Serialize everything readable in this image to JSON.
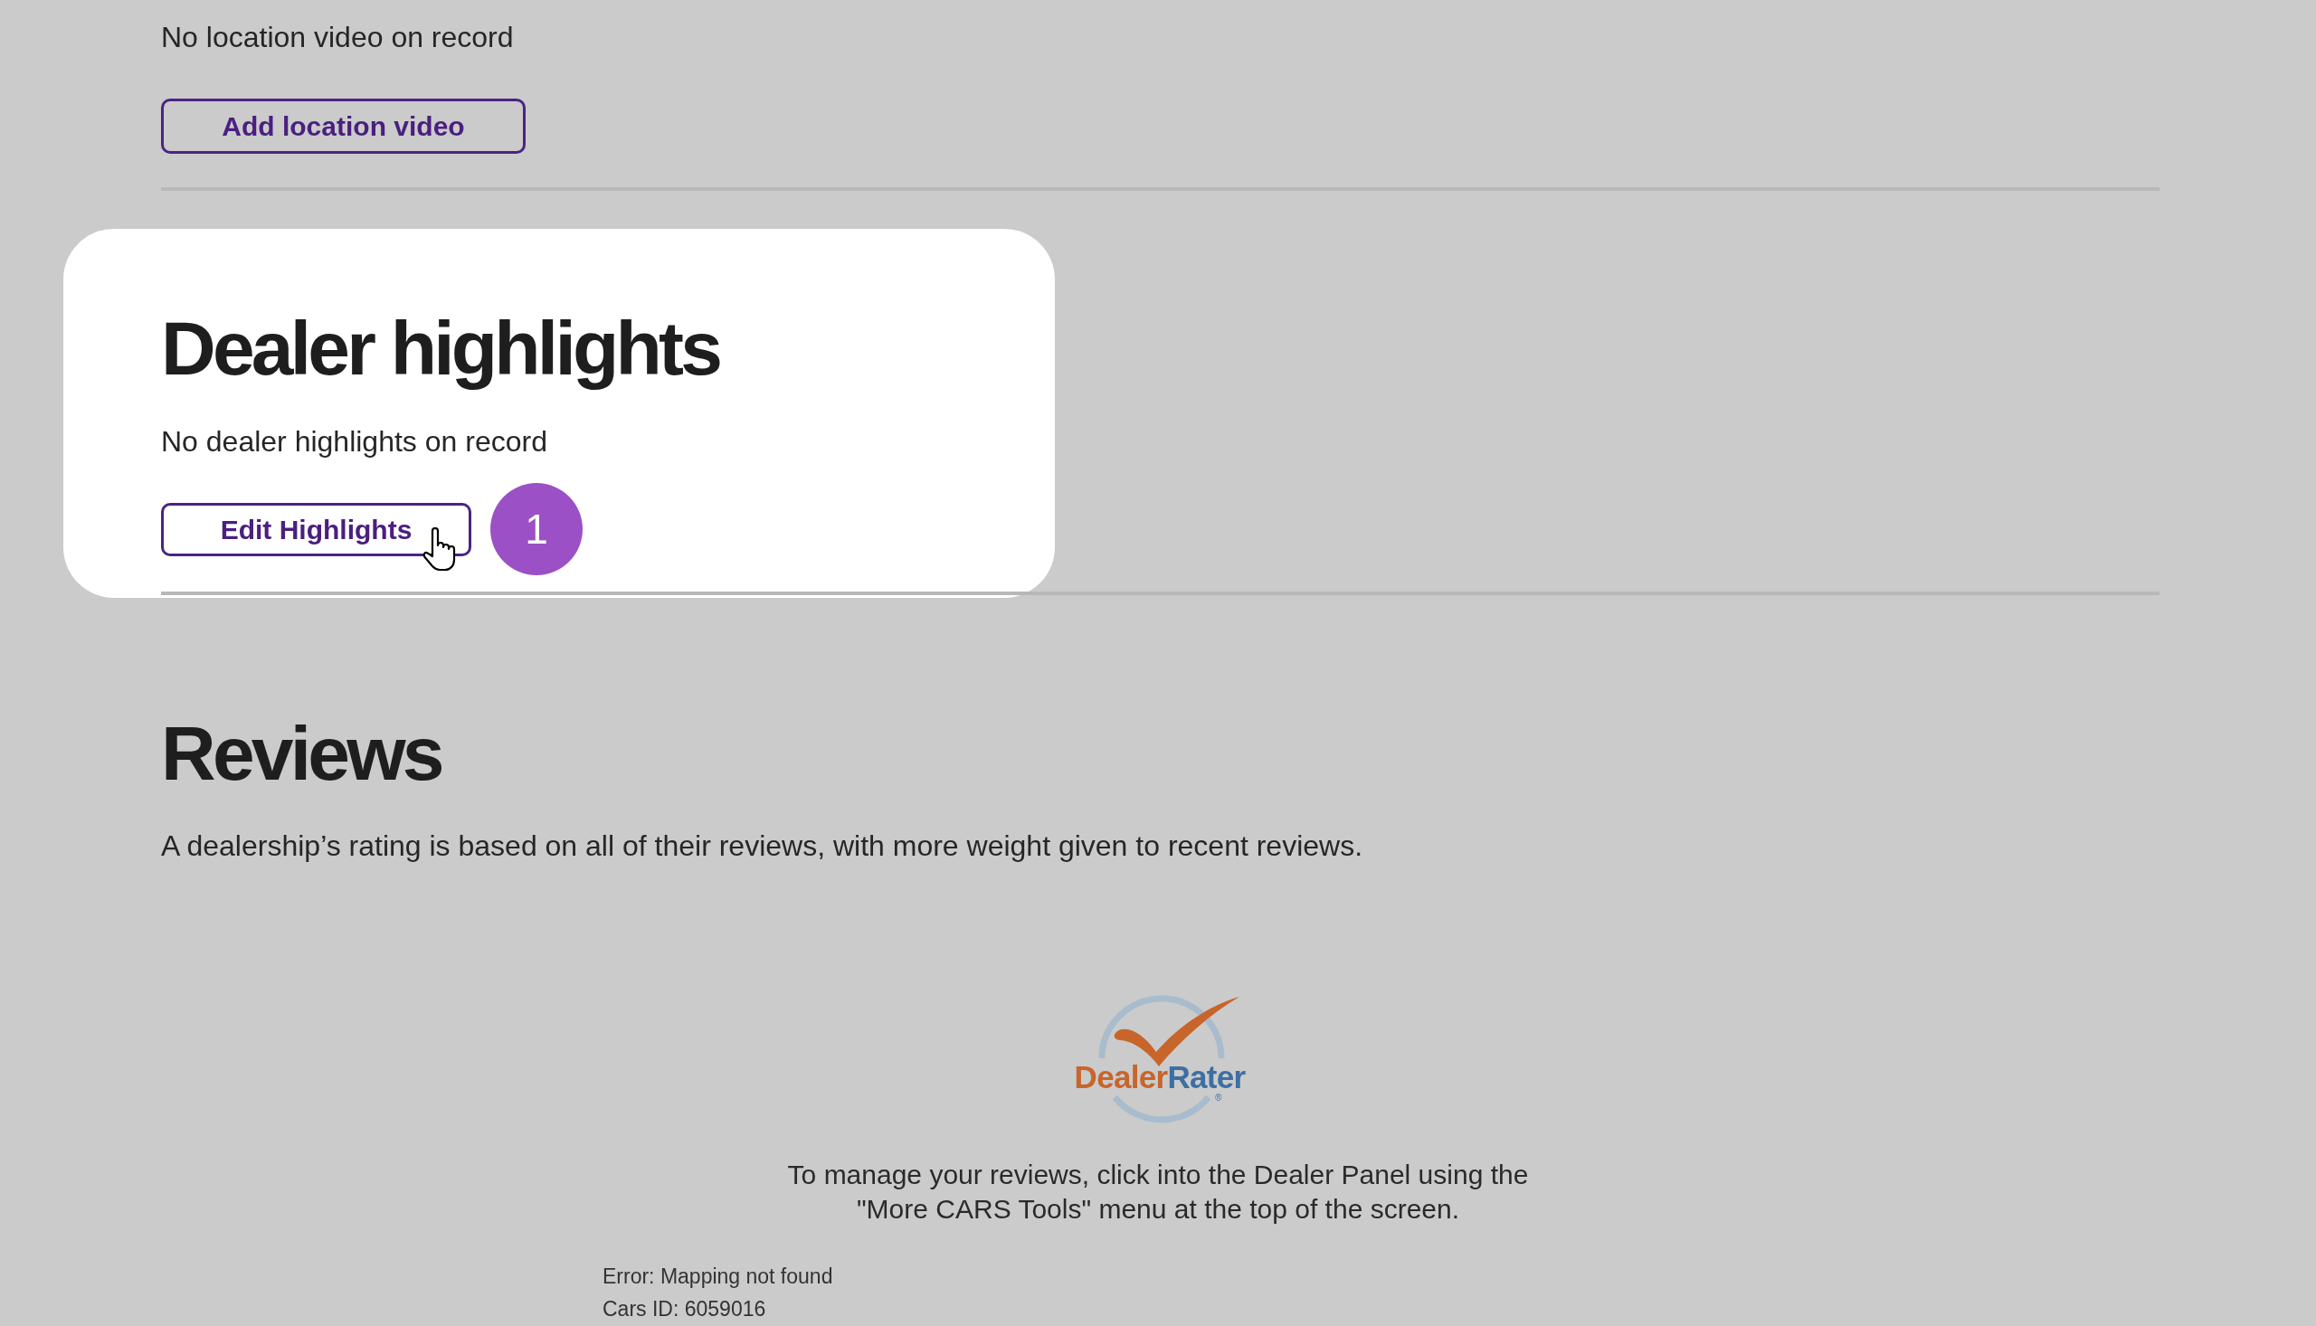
{
  "location_video": {
    "empty_message": "No location video on record",
    "add_button": "Add location video"
  },
  "dealer_highlights": {
    "title": "Dealer highlights",
    "empty_message": "No dealer highlights on record",
    "edit_button": "Edit Highlights",
    "step_badge": "1"
  },
  "reviews": {
    "title": "Reviews",
    "description": "A dealership’s rating is based on all of their reviews, with more weight given to recent reviews.",
    "logo": {
      "wordmark": [
        {
          "text": "Dealer",
          "color": "#c8652b"
        },
        {
          "text": "Rater",
          "color": "#3d6fa3"
        }
      ],
      "registered_mark": "®"
    },
    "instructions": "To manage your reviews, click into the Dealer Panel using the \"More CARS Tools\" menu at the top of the screen.",
    "debug_lines": [
      "Error: Mapping not found",
      "Cars ID: 6059016"
    ]
  }
}
